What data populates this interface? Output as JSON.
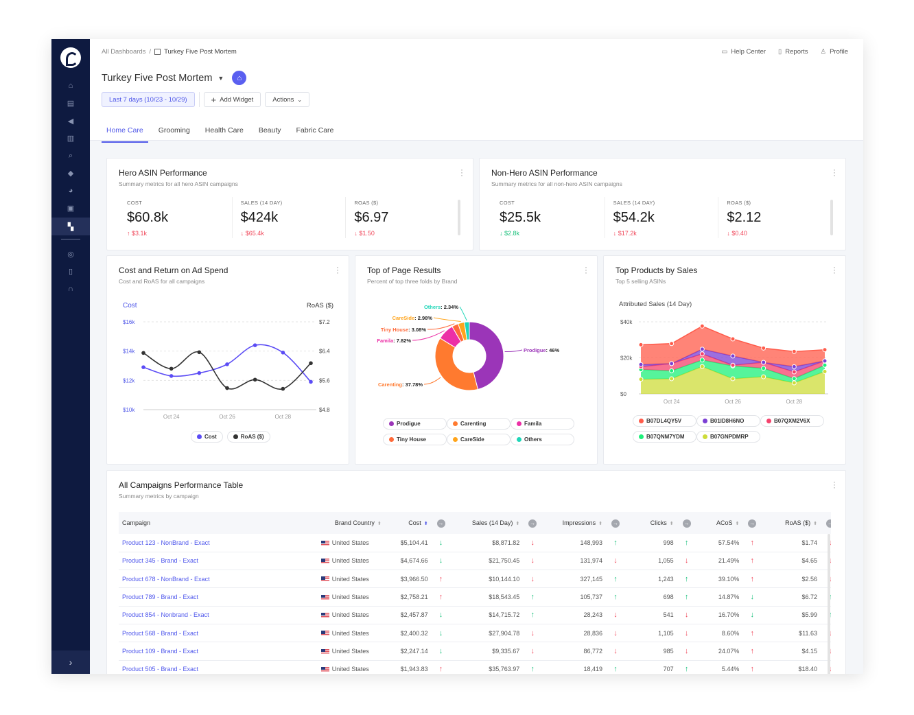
{
  "colors": {
    "accent": "#4e56e8",
    "up_bad": "#f0475a",
    "good": "#18c07a",
    "sidebar": "#0e1a40"
  },
  "sidebar": {
    "items": [
      {
        "icon": "home-icon",
        "glyph": "⌂"
      },
      {
        "icon": "store-icon",
        "glyph": "▤"
      },
      {
        "icon": "megaphone-icon",
        "glyph": "◀"
      },
      {
        "icon": "barcode-icon",
        "glyph": "▥"
      },
      {
        "icon": "search-icon",
        "glyph": "⌕"
      },
      {
        "icon": "tag-icon",
        "glyph": "◆"
      },
      {
        "icon": "pie-chart-icon",
        "glyph": "◕"
      },
      {
        "icon": "report-icon",
        "glyph": "▣"
      },
      {
        "icon": "dashboard-icon",
        "glyph": "▚",
        "active": true
      }
    ],
    "bottom_items": [
      {
        "icon": "globe-icon",
        "glyph": "◎"
      },
      {
        "icon": "document-icon",
        "glyph": "▯"
      },
      {
        "icon": "headset-icon",
        "glyph": "∩"
      }
    ],
    "collapse": "›"
  },
  "breadcrumb": {
    "root": "All Dashboards",
    "sep": "/",
    "current": "Turkey Five Post Mortem"
  },
  "toplinks": [
    {
      "icon": "book-icon",
      "glyph": "▭",
      "label": "Help Center"
    },
    {
      "icon": "file-icon",
      "glyph": "▯",
      "label": "Reports"
    },
    {
      "icon": "user-icon",
      "glyph": "♙",
      "label": "Profile"
    }
  ],
  "title": "Turkey Five Post Mortem",
  "toolbar": {
    "date_range": "Last 7 days (10/23 - 10/29)",
    "add_widget": "Add Widget",
    "actions": "Actions"
  },
  "tabs": [
    "Home Care",
    "Grooming",
    "Health Care",
    "Beauty",
    "Fabric Care"
  ],
  "active_tab": 0,
  "hero": {
    "title": "Hero ASIN Performance",
    "subtitle": "Summary metrics for all hero ASIN campaigns",
    "metrics": [
      {
        "label": "COST",
        "value": "$60.8k",
        "delta": "$3.1k",
        "dir": "up",
        "good": false
      },
      {
        "label": "SALES (14 DAY)",
        "value": "$424k",
        "delta": "$65.4k",
        "dir": "down",
        "good": false
      },
      {
        "label": "ROAS ($)",
        "value": "$6.97",
        "delta": "$1.50",
        "dir": "down",
        "good": false
      }
    ]
  },
  "nonhero": {
    "title": "Non-Hero ASIN Performance",
    "subtitle": "Summary metrics for all non-hero ASIN campaigns",
    "metrics": [
      {
        "label": "COST",
        "value": "$25.5k",
        "delta": "$2.8k",
        "dir": "down",
        "good": true
      },
      {
        "label": "SALES (14 DAY)",
        "value": "$54.2k",
        "delta": "$17.2k",
        "dir": "down",
        "good": false
      },
      {
        "label": "ROAS ($)",
        "value": "$2.12",
        "delta": "$0.40",
        "dir": "down",
        "good": false
      }
    ]
  },
  "cost_card": {
    "title": "Cost and Return on Ad Spend",
    "subtitle": "Cost and RoAS for all campaigns"
  },
  "pie_card": {
    "title": "Top of Page Results",
    "subtitle": "Percent of top three folds by Brand"
  },
  "products_card": {
    "title": "Top Products by Sales",
    "subtitle": "Top 5 selling ASINs"
  },
  "chart_data": [
    {
      "type": "line",
      "ylabel": "Cost",
      "y2label": "RoAS ($)",
      "x": [
        "Oct 23",
        "Oct 24",
        "Oct 25",
        "Oct 26",
        "Oct 27",
        "Oct 28",
        "Oct 29"
      ],
      "xticks": [
        "Oct 24",
        "Oct 26",
        "Oct 28"
      ],
      "ylim": [
        10000,
        16000
      ],
      "yticks": [
        "$10k",
        "$12k",
        "$14k",
        "$16k"
      ],
      "y2lim": [
        4.8,
        7.2
      ],
      "y2ticks": [
        "$4.8",
        "$5.6",
        "$6.4",
        "$7.2"
      ],
      "grid": true,
      "legend": "bottom",
      "series": [
        {
          "name": "Cost",
          "axis": "left",
          "color": "#5b4cf5",
          "values": [
            12900,
            12300,
            12500,
            13100,
            14400,
            13900,
            11900
          ]
        },
        {
          "name": "RoAS ($)",
          "axis": "right",
          "color": "#333333",
          "values": [
            6.35,
            5.92,
            6.37,
            5.39,
            5.62,
            5.37,
            6.07
          ]
        }
      ]
    },
    {
      "type": "pie",
      "donut": true,
      "legend": "bottom",
      "slices": [
        {
          "name": "Prodigue",
          "value": 46,
          "label": "46%",
          "color": "#9b35b8"
        },
        {
          "name": "Carenting",
          "value": 37.78,
          "label": "37.78%",
          "color": "#ff7a2f"
        },
        {
          "name": "Famila",
          "value": 7.82,
          "label": "7.82%",
          "color": "#ec2fa6"
        },
        {
          "name": "Tiny House",
          "value": 3.08,
          "label": "3.08%",
          "color": "#ff6a3a"
        },
        {
          "name": "CareSide",
          "value": 2.98,
          "label": "2.98%",
          "color": "#ffa41b"
        },
        {
          "name": "Others",
          "value": 2.34,
          "label": "2.34%",
          "color": "#1fd6b8"
        }
      ]
    },
    {
      "type": "area",
      "stacked": true,
      "title": "Attributed Sales (14 Day)",
      "x": [
        "Oct 23",
        "Oct 24",
        "Oct 25",
        "Oct 26",
        "Oct 27",
        "Oct 28",
        "Oct 29"
      ],
      "xticks": [
        "Oct 24",
        "Oct 26",
        "Oct 28"
      ],
      "ylim": [
        0,
        40000
      ],
      "yticks": [
        "$0",
        "$20k",
        "$40k"
      ],
      "grid": true,
      "legend": "bottom",
      "series": [
        {
          "name": "B07GNPDMRP",
          "color": "#cddc39",
          "values": [
            8100,
            8400,
            15200,
            8400,
            9500,
            6100,
            12400
          ]
        },
        {
          "name": "B07QNM7YDM",
          "color": "#1ef07a",
          "values": [
            5400,
            4400,
            3600,
            7100,
            4700,
            2400,
            3500
          ]
        },
        {
          "name": "B07QXM2V6X",
          "color": "#f5426c",
          "values": [
            1600,
            4000,
            3400,
            400,
            3300,
            3700,
            2400
          ]
        },
        {
          "name": "B01ID8H6NO",
          "color": "#7b3fd4",
          "values": [
            1200,
            0,
            2600,
            5100,
            0,
            2900,
            0
          ]
        },
        {
          "name": "B07DL4QY5V",
          "color": "#ff5b4a",
          "values": [
            11000,
            11100,
            12800,
            9500,
            7900,
            8400,
            6200
          ]
        }
      ],
      "legend_order": [
        "B07DL4QY5V",
        "B01ID8H6NO",
        "B07QXM2V6X",
        "B07QNM7YDM",
        "B07GNPDMRP"
      ]
    }
  ],
  "table": {
    "title": "All Campaigns Performance Table",
    "subtitle": "Summary metrics by campaign",
    "columns": [
      {
        "label": "Campaign"
      },
      {
        "label": "Brand Country"
      },
      {
        "label": "Cost",
        "inverse": true
      },
      {
        "label": "Sales (14 Day)"
      },
      {
        "label": "Impressions"
      },
      {
        "label": "Clicks"
      },
      {
        "label": "ACoS",
        "inverse": true
      },
      {
        "label": "RoAS ($)"
      }
    ],
    "rows": [
      {
        "campaign": "Product 123 - NonBrand - Exact",
        "country": "United States",
        "cells": [
          [
            "$5,104.41",
            "down"
          ],
          [
            "$8,871.82",
            "down"
          ],
          [
            "148,993",
            "up"
          ],
          [
            "998",
            "up"
          ],
          [
            "57.54%",
            "up"
          ],
          [
            "$1.74",
            "down"
          ]
        ]
      },
      {
        "campaign": "Product 345 - Brand - Exact",
        "country": "United States",
        "cells": [
          [
            "$4,674.66",
            "down"
          ],
          [
            "$21,750.45",
            "down"
          ],
          [
            "131,974",
            "down"
          ],
          [
            "1,055",
            "down"
          ],
          [
            "21.49%",
            "up"
          ],
          [
            "$4.65",
            "down"
          ]
        ]
      },
      {
        "campaign": "Product 678 - NonBrand - Exact",
        "country": "United States",
        "cells": [
          [
            "$3,966.50",
            "up"
          ],
          [
            "$10,144.10",
            "down"
          ],
          [
            "327,145",
            "up"
          ],
          [
            "1,243",
            "up"
          ],
          [
            "39.10%",
            "up"
          ],
          [
            "$2.56",
            "down"
          ]
        ]
      },
      {
        "campaign": "Product 789 - Brand - Exact",
        "country": "United States",
        "cells": [
          [
            "$2,758.21",
            "up"
          ],
          [
            "$18,543.45",
            "up"
          ],
          [
            "105,737",
            "up"
          ],
          [
            "698",
            "up"
          ],
          [
            "14.87%",
            "down"
          ],
          [
            "$6.72",
            "up"
          ]
        ]
      },
      {
        "campaign": "Product 854 - Nonbrand - Exact",
        "country": "United States",
        "cells": [
          [
            "$2,457.87",
            "down"
          ],
          [
            "$14,715.72",
            "up"
          ],
          [
            "28,243",
            "down"
          ],
          [
            "541",
            "down"
          ],
          [
            "16.70%",
            "down"
          ],
          [
            "$5.99",
            "up"
          ]
        ]
      },
      {
        "campaign": "Product 568 - Brand - Exact",
        "country": "United States",
        "cells": [
          [
            "$2,400.32",
            "down"
          ],
          [
            "$27,904.78",
            "down"
          ],
          [
            "28,836",
            "down"
          ],
          [
            "1,105",
            "down"
          ],
          [
            "8.60%",
            "up"
          ],
          [
            "$11.63",
            "down"
          ]
        ]
      },
      {
        "campaign": "Product 109 - Brand - Exact",
        "country": "United States",
        "cells": [
          [
            "$2,247.14",
            "down"
          ],
          [
            "$9,335.67",
            "down"
          ],
          [
            "86,772",
            "down"
          ],
          [
            "985",
            "down"
          ],
          [
            "24.07%",
            "up"
          ],
          [
            "$4.15",
            "down"
          ]
        ]
      },
      {
        "campaign": "Product 505 - Brand - Exact",
        "country": "United States",
        "cells": [
          [
            "$1,943.83",
            "up"
          ],
          [
            "$35,763.97",
            "up"
          ],
          [
            "18,419",
            "up"
          ],
          [
            "707",
            "up"
          ],
          [
            "5.44%",
            "up"
          ],
          [
            "$18.40",
            "down"
          ]
        ]
      }
    ]
  }
}
